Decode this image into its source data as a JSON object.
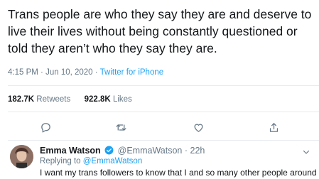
{
  "tweet": {
    "text": "Trans people are who they say they are and deserve to live their lives without being constantly questioned or told they aren’t who they say they are.",
    "time": "4:15 PM",
    "separator": "·",
    "date": "Jun 10, 2020",
    "source": "Twitter for iPhone"
  },
  "stats": {
    "retweets_count": "182.7K",
    "retweets_label": "Retweets",
    "likes_count": "922.8K",
    "likes_label": "Likes"
  },
  "actions": {
    "icons": [
      "reply-icon",
      "retweet-icon",
      "like-icon",
      "share-icon"
    ]
  },
  "reply": {
    "name": "Emma Watson",
    "handle": "@EmmaWatson",
    "separator": "·",
    "time": "22h",
    "replying_to_label": "Replying to",
    "replying_to_handle": "@EmmaWatson",
    "text": "I want my trans followers to know that I and so many other people around"
  },
  "colors": {
    "text": "#14171a",
    "muted": "#657786",
    "accent": "#1da1f2",
    "divider": "#e6ecf0"
  }
}
